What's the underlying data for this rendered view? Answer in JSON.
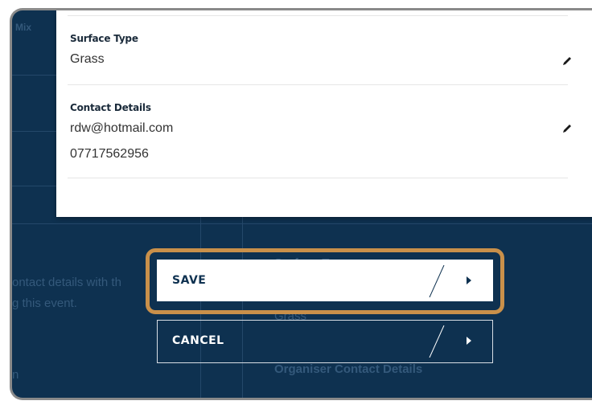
{
  "background": {
    "tab_fragment": "Mix",
    "left_text_line1": "ontact details with th",
    "left_text_line2": "g this event.",
    "left_text_line3": "n",
    "right_label_1": "Surface Type",
    "right_label_2": "Grass",
    "right_label_3": "Organiser Contact Details"
  },
  "panel": {
    "surface_type": {
      "label": "Surface Type",
      "value": "Grass"
    },
    "contact_details": {
      "label": "Contact Details",
      "email": "rdw@hotmail.com",
      "phone": "07717562956"
    }
  },
  "actions": {
    "save_label": "SAVE",
    "cancel_label": "CANCEL"
  },
  "colors": {
    "background_navy": "#0e3150",
    "highlight": "#c9904a"
  },
  "icons": {
    "edit": "pencil-icon",
    "arrow": "chevron-right-icon"
  }
}
